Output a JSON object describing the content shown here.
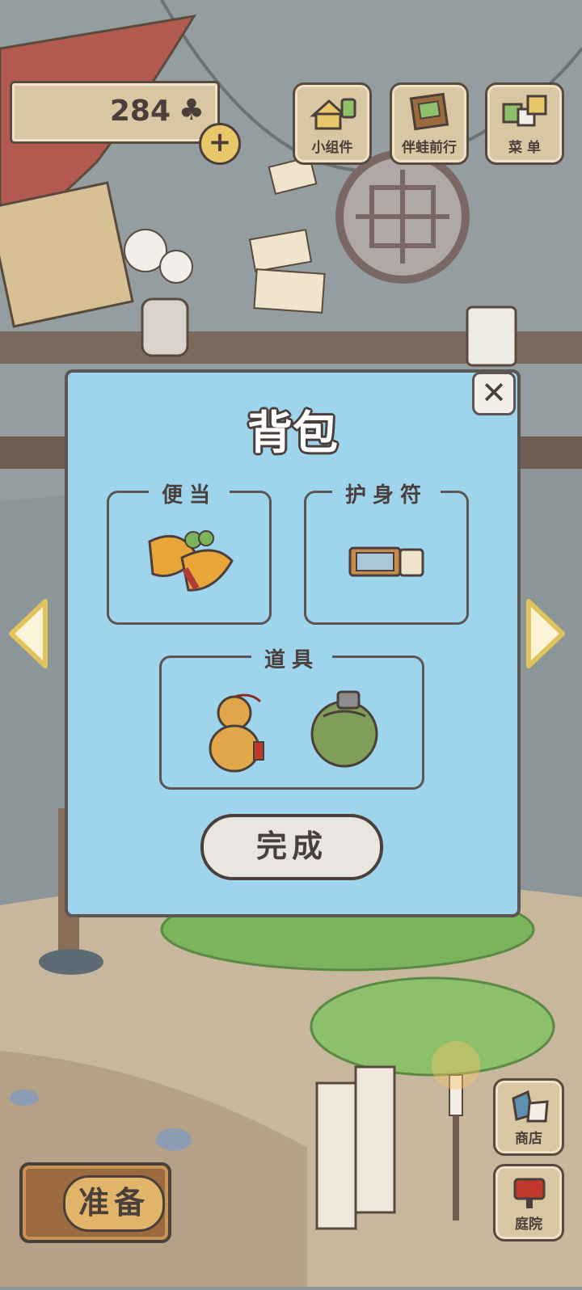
{
  "hud": {
    "clover_count": "284",
    "clover_icon": "clover-icon",
    "add_icon": "plus-icon"
  },
  "top_menu": [
    {
      "label": "小组件",
      "icon": "widget-icon"
    },
    {
      "label": "伴蛙前行",
      "icon": "journal-icon"
    },
    {
      "label": "菜 单",
      "icon": "menu-icon"
    }
  ],
  "bag": {
    "title": "背包",
    "sections": {
      "lunch": {
        "label": "便当",
        "item_icon": "lunch-food-icon"
      },
      "charm": {
        "label": "护身符",
        "item_icon": "charm-ticket-icon"
      },
      "tools": {
        "label": "道具",
        "item_icons": [
          "gourd-icon",
          "canteen-icon"
        ]
      }
    },
    "done_label": "完成",
    "close_icon": "close-icon"
  },
  "side_buttons": {
    "shop": {
      "label": "商店",
      "icon": "shop-bag-icon"
    },
    "yard": {
      "label": "庭院",
      "icon": "mailbox-icon"
    }
  },
  "prepare_label": "准备",
  "colors": {
    "panel": "#9fd4ed",
    "outline": "#5b5554",
    "wood": "#d9c7a3",
    "background": "#8e9699"
  }
}
